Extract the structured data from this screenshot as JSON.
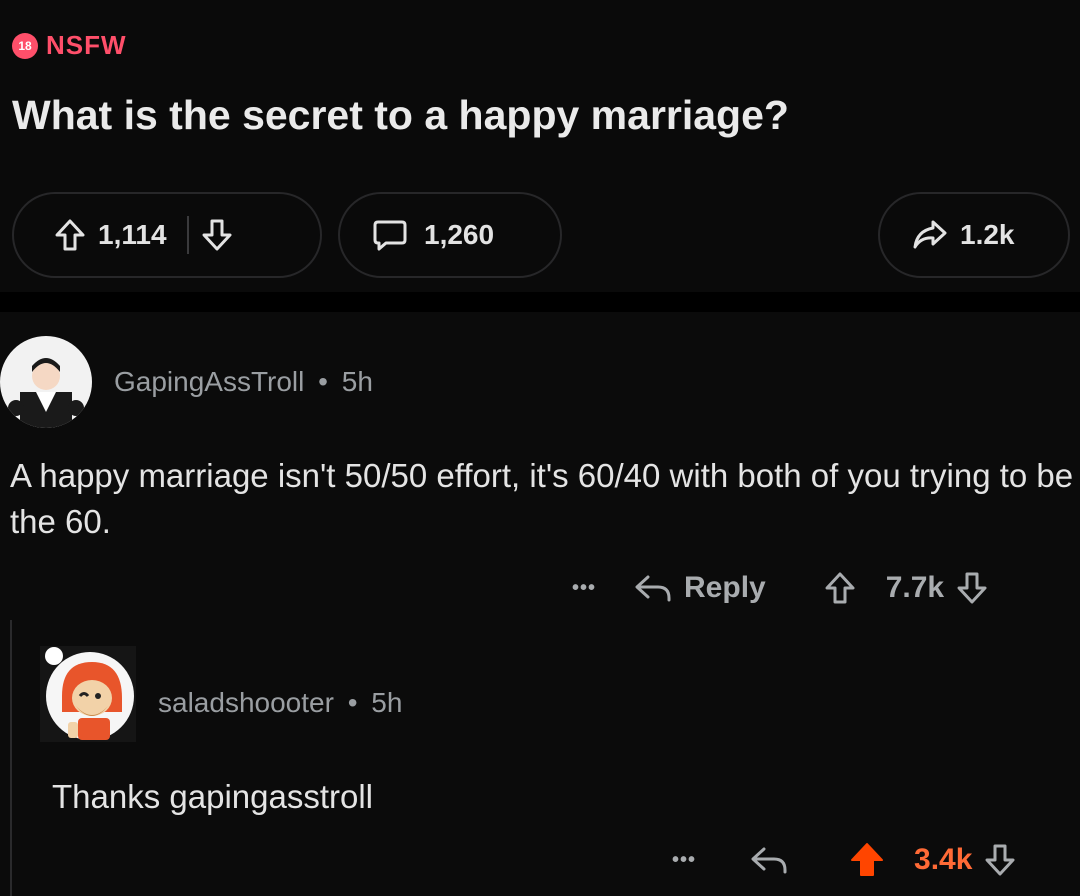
{
  "post": {
    "nsfw_badge": "18",
    "nsfw_label": "NSFW",
    "title": "What is the secret to a happy marriage?",
    "upvotes": "1,114",
    "comments": "1,260",
    "shares": "1.2k"
  },
  "comments": [
    {
      "username": "GapingAssTroll",
      "dot": "•",
      "time": "5h",
      "body": "A happy marriage isn't 50/50 effort, it's 60/40 with both of you trying to be the 60.",
      "more": "•••",
      "reply_label": "Reply",
      "score": "7.7k"
    },
    {
      "username": "saladshoooter",
      "dot": "•",
      "time": "5h",
      "body": "Thanks gapingasstroll",
      "more": "•••",
      "score": "3.4k"
    }
  ],
  "colors": {
    "background": "#0b0b0b",
    "nsfw": "#ff4f6a",
    "upvote_active": "#ff4500",
    "upvote_score": "#ff6a36"
  },
  "icons": [
    "upvote-icon",
    "downvote-icon",
    "comment-icon",
    "share-icon",
    "reply-icon"
  ]
}
